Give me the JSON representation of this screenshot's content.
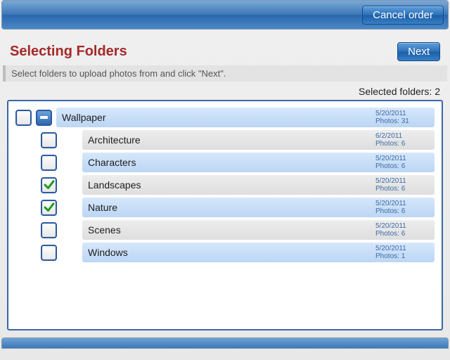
{
  "topbar": {
    "cancel_label": "Cancel order"
  },
  "heading": "Selecting Folders",
  "next_label": "Next",
  "instruction": "Select folders to upload photos from and click \"Next\".",
  "selected_label": "Selected folders: 2",
  "root": {
    "name": "Wallpaper",
    "date": "5/20/2011",
    "photos": "Photos: 31",
    "state": "partial"
  },
  "children": [
    {
      "name": "Architecture",
      "date": "6/2/2011",
      "photos": "Photos: 6",
      "checked": false,
      "alt": true
    },
    {
      "name": "Characters",
      "date": "5/20/2011",
      "photos": "Photos: 6",
      "checked": false,
      "alt": false
    },
    {
      "name": "Landscapes",
      "date": "5/20/2011",
      "photos": "Photos: 6",
      "checked": true,
      "alt": true
    },
    {
      "name": "Nature",
      "date": "5/20/2011",
      "photos": "Photos: 6",
      "checked": true,
      "alt": false
    },
    {
      "name": "Scenes",
      "date": "5/20/2011",
      "photos": "Photos: 6",
      "checked": false,
      "alt": true
    },
    {
      "name": "Windows",
      "date": "5/20/2011",
      "photos": "Photos: 1",
      "checked": false,
      "alt": false
    }
  ]
}
